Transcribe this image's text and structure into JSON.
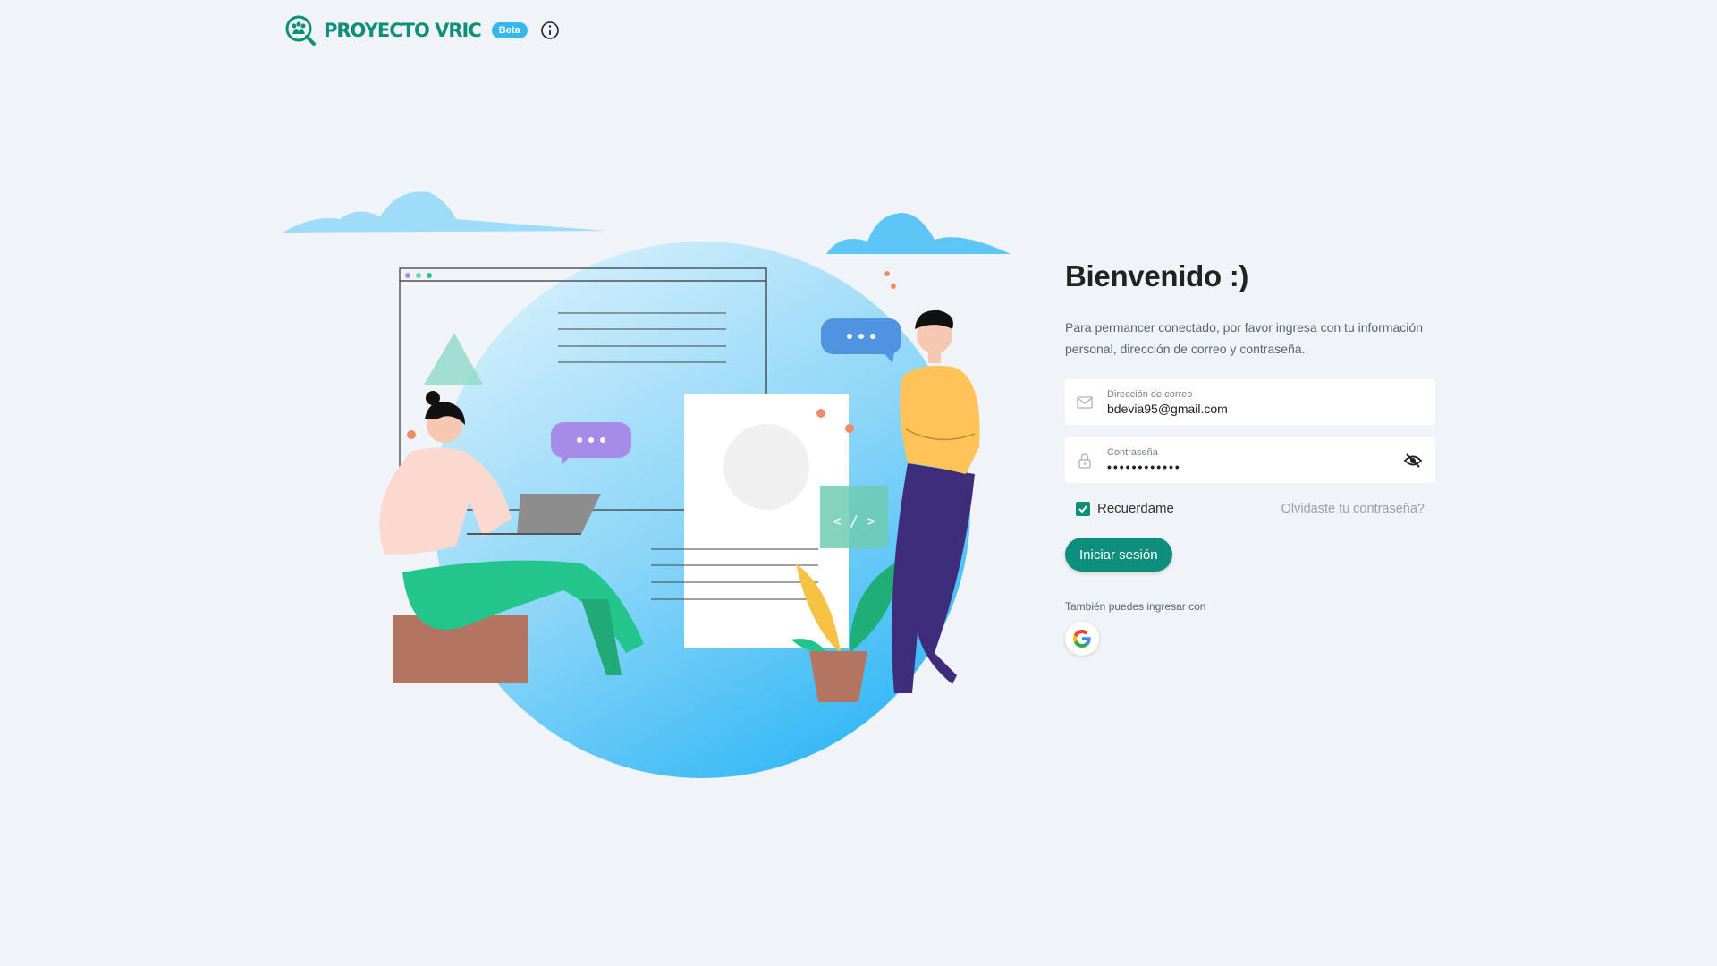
{
  "header": {
    "brand": "PROYECTO VRIC",
    "badge": "Beta"
  },
  "login": {
    "title": "Bienvenido :)",
    "subtitle": "Para permancer conectado, por favor ingresa con tu información personal, dirección de correo y contraseña.",
    "email_label": "Dirección de correo",
    "email_value": "bdevia95@gmail.com",
    "password_label": "Contraseña",
    "password_value": "••••••••••••",
    "remember_label": "Recuerdame",
    "remember_checked": true,
    "forgot_label": "Olvidaste tu contraseña?",
    "submit_label": "Iniciar sesión",
    "alt_text": "También puedes ingresar con"
  },
  "illustration": {
    "code_tag": "< / >"
  },
  "colors": {
    "brand": "#0f8f77",
    "beta": "#38b6f0",
    "button": "#0e8f7e",
    "background": "#f0f3f7"
  },
  "icons": [
    "logo-icon",
    "info-icon",
    "mail-icon",
    "lock-icon",
    "eye-off-icon",
    "check-icon",
    "google-icon"
  ]
}
